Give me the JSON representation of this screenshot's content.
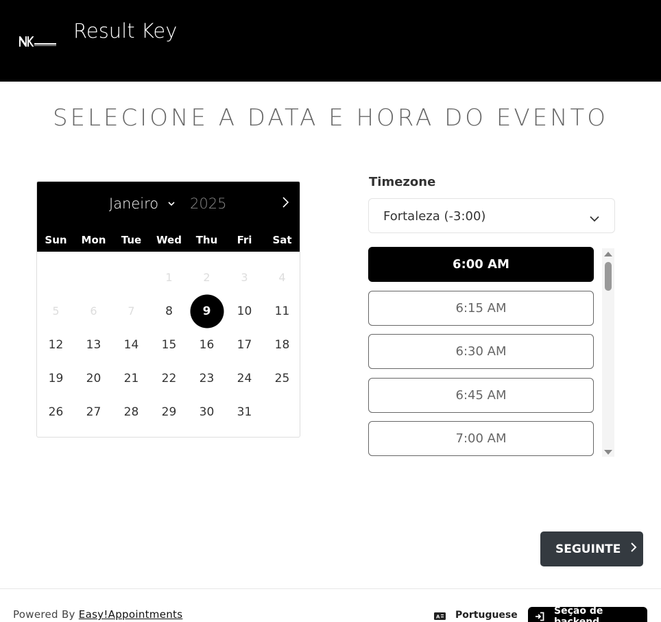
{
  "header": {
    "title": "Result Key",
    "logo_icon": "rk-logo-icon"
  },
  "page_title": "SELECIONE A DATA E HORA DO EVENTO",
  "calendar": {
    "month": "Janeiro",
    "year": "2025",
    "weekdays": [
      "Sun",
      "Mon",
      "Tue",
      "Wed",
      "Thu",
      "Fri",
      "Sat"
    ],
    "leading_blank_days": 3,
    "days": [
      {
        "d": "1",
        "disabled": true
      },
      {
        "d": "2",
        "disabled": true
      },
      {
        "d": "3",
        "disabled": true
      },
      {
        "d": "4",
        "disabled": true
      },
      {
        "d": "5",
        "disabled": true
      },
      {
        "d": "6",
        "disabled": true
      },
      {
        "d": "7",
        "disabled": true
      },
      {
        "d": "8"
      },
      {
        "d": "9",
        "selected": true
      },
      {
        "d": "10"
      },
      {
        "d": "11"
      },
      {
        "d": "12"
      },
      {
        "d": "13"
      },
      {
        "d": "14"
      },
      {
        "d": "15"
      },
      {
        "d": "16"
      },
      {
        "d": "17"
      },
      {
        "d": "18"
      },
      {
        "d": "19"
      },
      {
        "d": "20"
      },
      {
        "d": "21"
      },
      {
        "d": "22"
      },
      {
        "d": "23"
      },
      {
        "d": "24"
      },
      {
        "d": "25"
      },
      {
        "d": "26"
      },
      {
        "d": "27"
      },
      {
        "d": "28"
      },
      {
        "d": "29"
      },
      {
        "d": "30"
      },
      {
        "d": "31"
      }
    ]
  },
  "timezone": {
    "label": "Timezone",
    "value": "Fortaleza (-3:00)"
  },
  "time_slots": [
    {
      "label": "6:00 AM",
      "active": true
    },
    {
      "label": "6:15 AM"
    },
    {
      "label": "6:30 AM"
    },
    {
      "label": "6:45 AM"
    },
    {
      "label": "7:00 AM"
    }
  ],
  "next_button": {
    "label": "SEGUINTE"
  },
  "footer": {
    "powered_by": "Powered By",
    "powered_link": "Easy!Appointments",
    "language": "Portuguese",
    "backend_label": "Seção de backend"
  },
  "colors": {
    "header_bg": "#000000",
    "accent": "#000000",
    "button_dark": "#343a40"
  }
}
